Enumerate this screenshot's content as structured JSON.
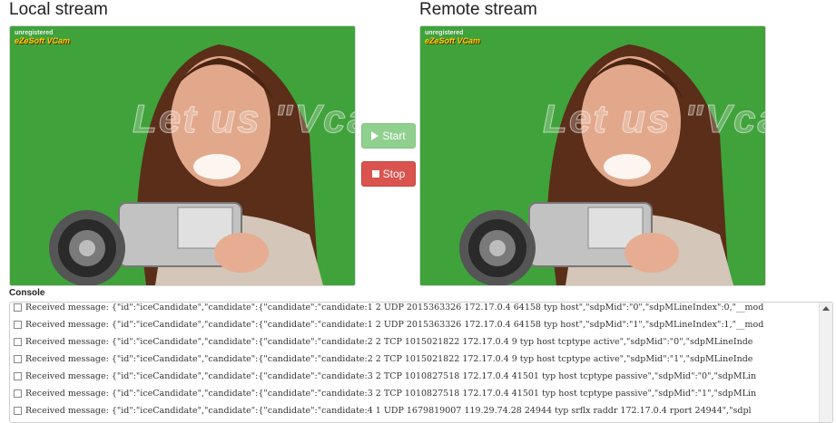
{
  "local": {
    "title": "Local stream"
  },
  "remote": {
    "title": "Remote stream"
  },
  "watermark": {
    "small": "unregistered",
    "brand": "eZeSoft VCam",
    "big": "Let us \"Vcam\""
  },
  "controls": {
    "start_label": "Start",
    "stop_label": "Stop"
  },
  "console": {
    "label": "Console",
    "lines": [
      "Received message: {\"id\":\"iceCandidate\",\"candidate\":{\"candidate\":\"candidate:1 2 UDP 2015363326 172.17.0.4 64158 typ host\",\"sdpMid\":\"0\",\"sdpMLineIndex\":0,\"__mod",
      "Received message: {\"id\":\"iceCandidate\",\"candidate\":{\"candidate\":\"candidate:1 2 UDP 2015363326 172.17.0.4 64158 typ host\",\"sdpMid\":\"1\",\"sdpMLineIndex\":1,\"__mod",
      "Received message: {\"id\":\"iceCandidate\",\"candidate\":{\"candidate\":\"candidate:2 2 TCP 1015021822 172.17.0.4 9 typ host tcptype active\",\"sdpMid\":\"0\",\"sdpMLineInde",
      "Received message: {\"id\":\"iceCandidate\",\"candidate\":{\"candidate\":\"candidate:2 2 TCP 1015021822 172.17.0.4 9 typ host tcptype active\",\"sdpMid\":\"1\",\"sdpMLineInde",
      "Received message: {\"id\":\"iceCandidate\",\"candidate\":{\"candidate\":\"candidate:3 2 TCP 1010827518 172.17.0.4 41501 typ host tcptype passive\",\"sdpMid\":\"0\",\"sdpMLin",
      "Received message: {\"id\":\"iceCandidate\",\"candidate\":{\"candidate\":\"candidate:3 2 TCP 1010827518 172.17.0.4 41501 typ host tcptype passive\",\"sdpMid\":\"1\",\"sdpMLin",
      "Received message: {\"id\":\"iceCandidate\",\"candidate\":{\"candidate\":\"candidate:4 1 UDP 1679819007 119.29.74.28 24944 typ srflx raddr 172.17.0.4 rport 24944\",\"sdpl"
    ]
  }
}
